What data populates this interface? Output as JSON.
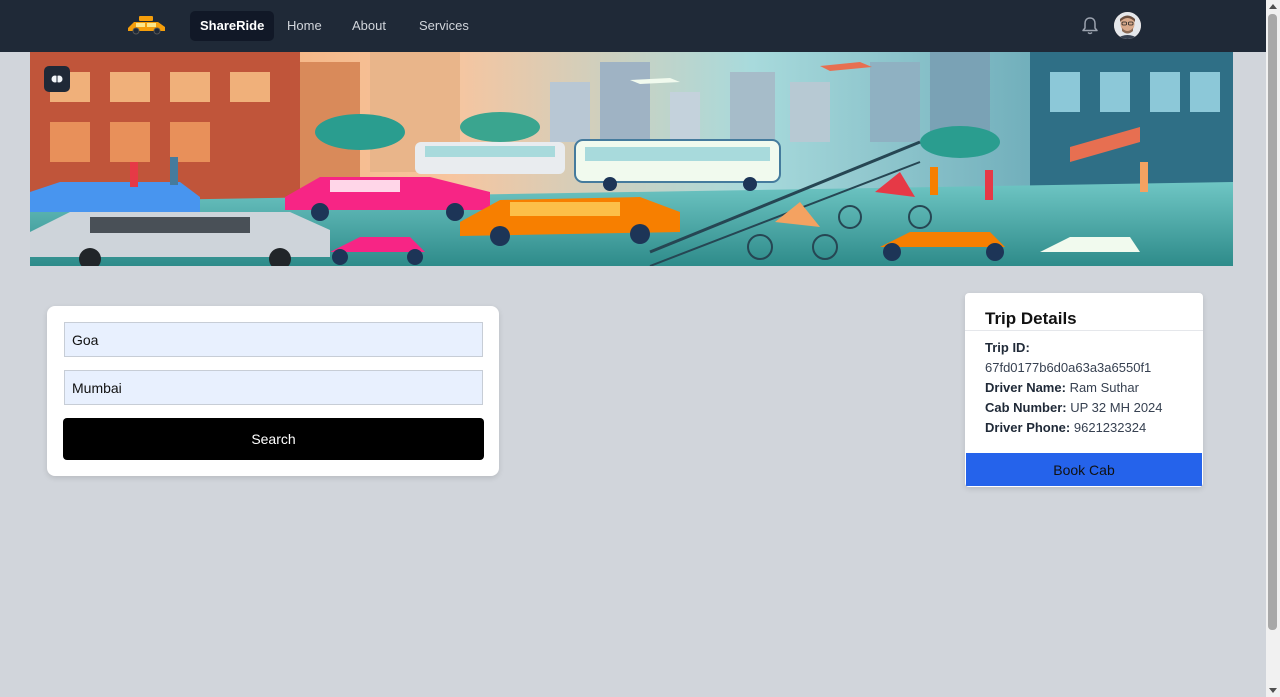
{
  "navbar": {
    "brand": "ShareRide",
    "links": [
      {
        "label": "Home"
      },
      {
        "label": "About"
      },
      {
        "label": "Services"
      }
    ],
    "icons": {
      "logo": "taxi-car-icon",
      "notifications": "bell-icon",
      "avatar": "user-avatar"
    }
  },
  "hero": {
    "image": "city-traffic-illustration",
    "badge_icon": "brain-icon"
  },
  "search": {
    "from_value": "Goa",
    "to_value": "Mumbai",
    "button_label": "Search"
  },
  "trip": {
    "title": "Trip Details",
    "trip_id_label": "Trip ID:",
    "trip_id": "67fd0177b6d0a63a3a6550f1",
    "driver_name_label": "Driver Name:",
    "driver_name": "Ram Suthar",
    "cab_number_label": "Cab Number:",
    "cab_number": "UP 32 MH 2024",
    "driver_phone_label": "Driver Phone:",
    "driver_phone": "9621232324",
    "book_label": "Book Cab"
  },
  "colors": {
    "navbar_bg": "#1f2937",
    "page_bg": "#d1d5db",
    "primary_button": "#2563eb",
    "search_button": "#000000",
    "input_bg": "#e8f0fe"
  }
}
